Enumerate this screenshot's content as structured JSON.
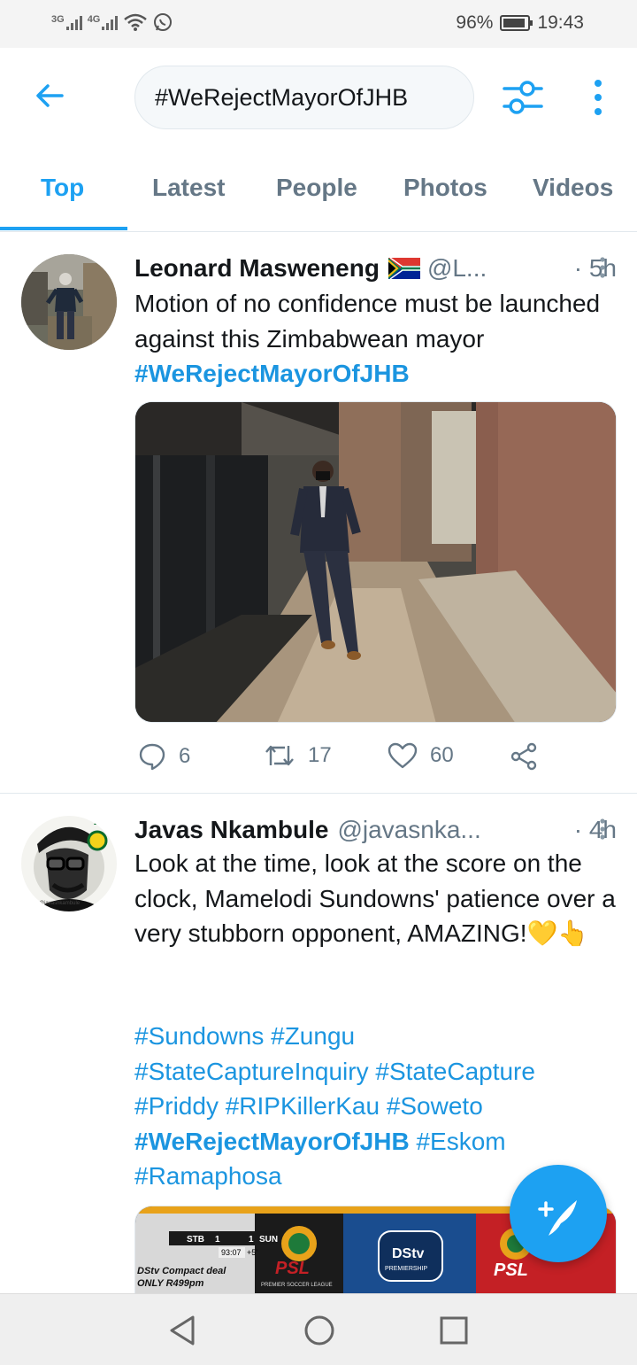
{
  "status_bar": {
    "network_1": "3G",
    "network_2": "4G",
    "battery_percent": "96%",
    "time": "19:43"
  },
  "header": {
    "search_query": "#WeRejectMayorOfJHB"
  },
  "tabs": [
    {
      "label": "Top",
      "active": true
    },
    {
      "label": "Latest",
      "active": false
    },
    {
      "label": "People",
      "active": false
    },
    {
      "label": "Photos",
      "active": false
    },
    {
      "label": "Videos",
      "active": false
    }
  ],
  "tweets": [
    {
      "name": "Leonard Masweneng",
      "handle": "@L...",
      "time": "· 5h",
      "text_plain": "Motion of no confidence must be launched against this Zimbabwean mayor ",
      "text_hashtag": "#WeRejectMayorOfJHB",
      "replies": "6",
      "retweets": "17",
      "likes": "60"
    },
    {
      "name": "Javas Nkambule",
      "handle": "@javasnka...",
      "time": "· 4h",
      "text": "Look at the time, look at the score on the clock,  Mamelodi Sundowns' patience over a very stubborn opponent, AMAZING!💛👆",
      "hashtags": [
        "#Sundowns",
        "#Zungu",
        "#StateCaptureInquiry",
        "#StateCapture",
        "#Priddy",
        "#RIPKillerKau",
        "#Soweto",
        "#WeRejectMayorOfJHB",
        "#Eskom",
        "#Ramaphosa"
      ],
      "avatar_watermark": "@javasnkambule",
      "media_texts": {
        "score_team1": "STB",
        "score_1": "1",
        "score_2": "1",
        "score_team2": "SUN",
        "clock": "93:07",
        "added": "+5'",
        "ad_line1": "DStv Compact deal",
        "ad_line2": "ONLY R499pm",
        "dstv": "DStv",
        "premiership": "PREMIERSHIP",
        "psl": "PSL",
        "psl_sub": "PREMIER SOCCER LEAGUE"
      }
    }
  ],
  "colors": {
    "accent": "#1da1f2",
    "hashtag": "#1b95e0",
    "secondary_text": "#657786",
    "border": "#e1e8ed"
  },
  "icons": [
    "back-arrow-icon",
    "filter-icon",
    "more-vertical-icon",
    "reply-icon",
    "retweet-icon",
    "like-icon",
    "share-icon",
    "compose-tweet-icon",
    "nav-back-icon",
    "nav-home-icon",
    "nav-recents-icon"
  ]
}
